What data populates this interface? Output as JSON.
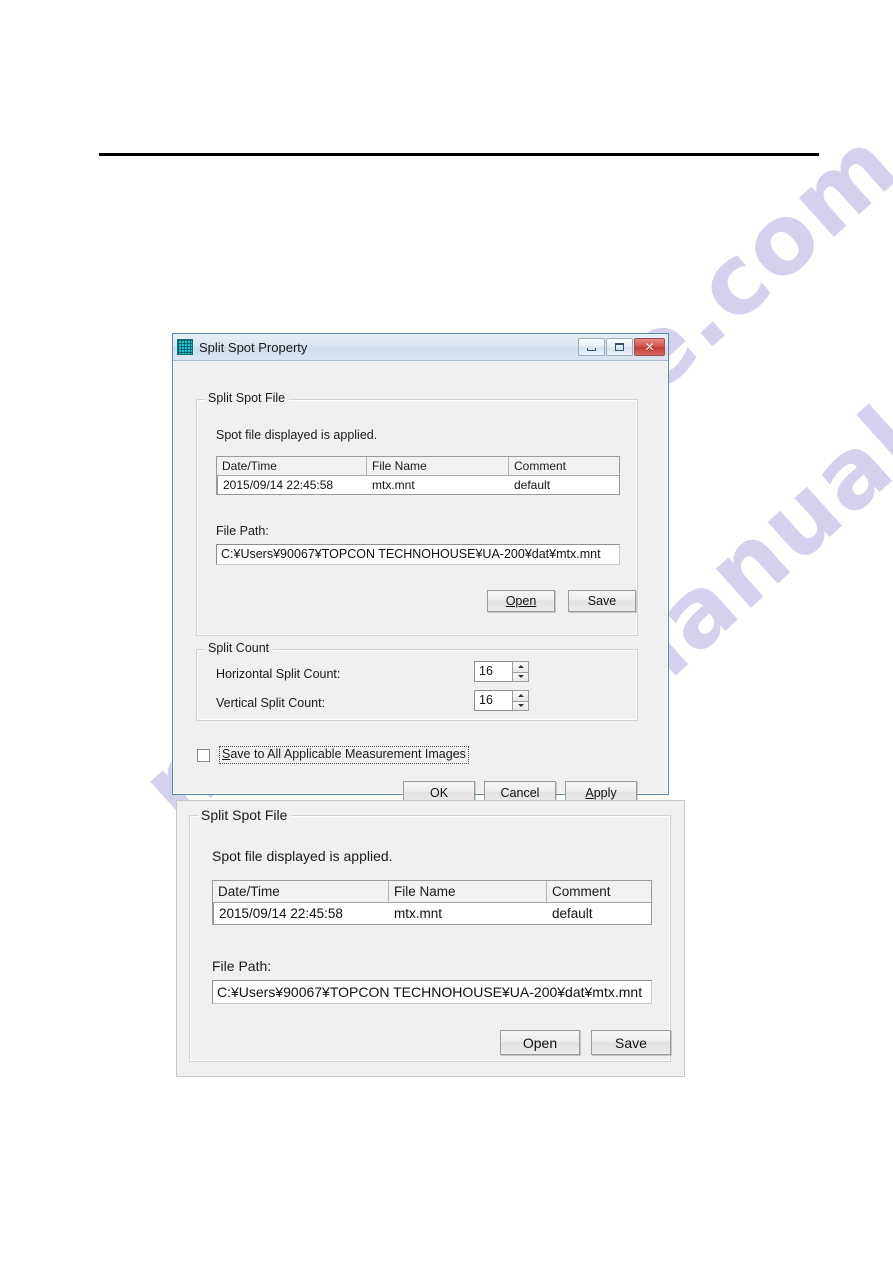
{
  "document": {
    "rule_present": true,
    "watermark_text": "manualshive.com",
    "watermark_color": "#b9b5e4"
  },
  "dialog": {
    "title": "Split Spot Property",
    "icon": "matrix-grid-icon",
    "accent_border": "#5a8ca8",
    "titlebar_buttons": [
      {
        "name": "minimize",
        "glyph": "–"
      },
      {
        "name": "maximize",
        "glyph": "□"
      },
      {
        "name": "close",
        "glyph": "✕",
        "color": "#c0392b"
      }
    ],
    "split_spot_file": {
      "legend": "Split Spot File",
      "hint": "Spot file displayed is applied.",
      "table": {
        "columns": [
          "Date/Time",
          "File Name",
          "Comment"
        ],
        "rows": [
          [
            "2015/09/14 22:45:58",
            "mtx.mnt",
            "default"
          ]
        ]
      },
      "file_path_label": "File Path:",
      "file_path_value": "C:¥Users¥90067¥TOPCON TECHNOHOUSE¥UA-200¥dat¥mtx.mnt",
      "open_button": "Open",
      "save_button": "Save"
    },
    "split_count": {
      "legend": "Split Count",
      "horizontal_label": "Horizontal Split Count:",
      "horizontal_value": "16",
      "vertical_label": "Vertical Split Count:",
      "vertical_value": "16"
    },
    "save_all_checkbox": {
      "accesskey": "S",
      "label_rest": "ave to All Applicable Measurement Images",
      "checked": false
    },
    "footer_buttons": {
      "ok": "OK",
      "cancel": "Cancel",
      "apply_accesskey": "A",
      "apply_rest": "pply"
    }
  },
  "detail_panel": {
    "legend": "Split Spot File",
    "hint": "Spot file displayed is applied.",
    "table": {
      "columns": [
        "Date/Time",
        "File Name",
        "Comment"
      ],
      "rows": [
        [
          "2015/09/14 22:45:58",
          "mtx.mnt",
          "default"
        ]
      ]
    },
    "file_path_label": "File Path:",
    "file_path_value": "C:¥Users¥90067¥TOPCON TECHNOHOUSE¥UA-200¥dat¥mtx.mnt",
    "open_button": "Open",
    "save_button": "Save"
  }
}
